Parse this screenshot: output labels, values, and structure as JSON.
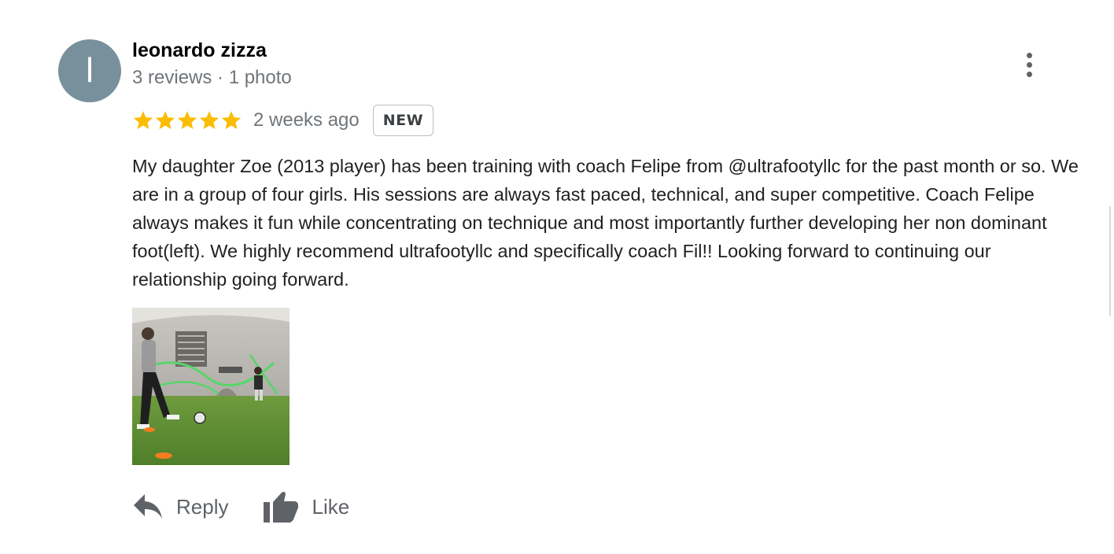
{
  "reviewer": {
    "initial": "l",
    "name": "leonardo zizza",
    "meta": "3 reviews · 1 photo"
  },
  "review": {
    "rating": 5,
    "rating_max": 5,
    "star_color": "#fbbc04",
    "timestamp": "2 weeks ago",
    "badge": "NEW",
    "text": "My daughter Zoe (2013 player) has been training with coach Felipe from @ultrafootyllc for the past month or so. We are in a group of four girls. His sessions are always fast paced, technical, and super competitive. Coach Felipe always makes it fun while concentrating on technique and most importantly further developing her non dominant foot(left). We highly recommend ultrafootyllc and specifically coach Fil!! Looking forward to continuing our relationship going forward."
  },
  "photo": {
    "description_icon": "review-photo"
  },
  "actions": {
    "reply_label": "Reply",
    "like_label": "Like"
  },
  "icons": {
    "more": "more-vert-icon",
    "reply": "reply-icon",
    "like": "thumb-up-icon"
  },
  "colors": {
    "avatar_bg": "#78909c",
    "secondary_text": "#70757a",
    "icon_gray": "#5f6368"
  }
}
